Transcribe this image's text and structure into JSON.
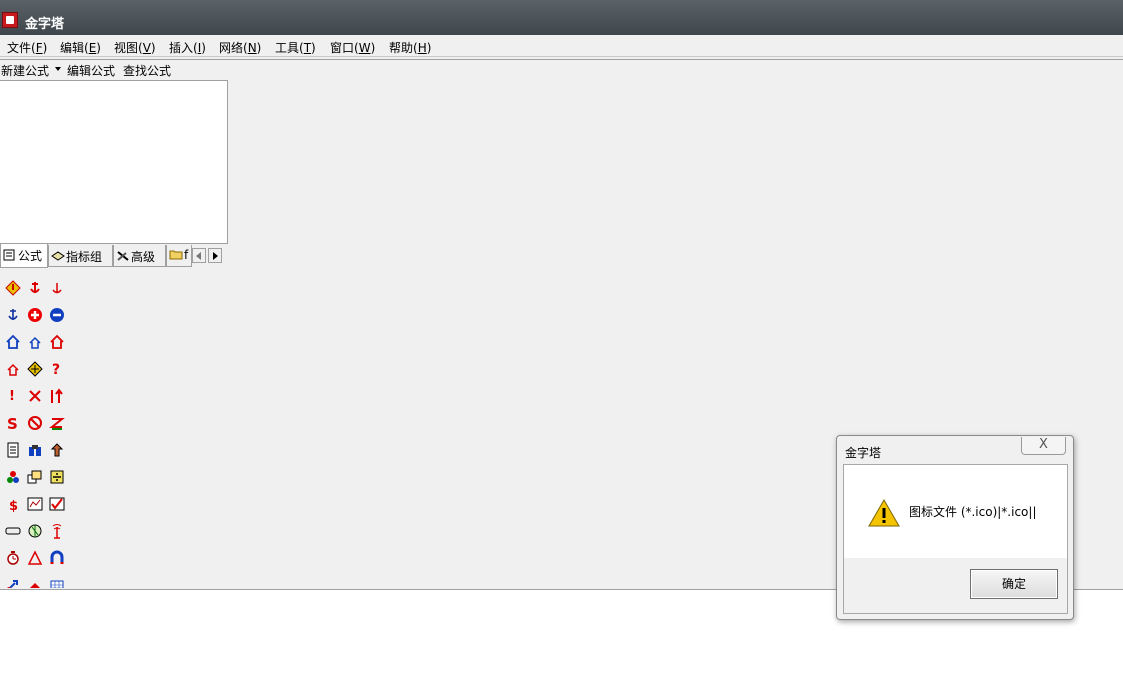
{
  "window": {
    "title": "金字塔"
  },
  "menubar": {
    "items": [
      {
        "label": "文件(",
        "key": "F",
        "close": ")"
      },
      {
        "label": "编辑(",
        "key": "E",
        "close": ")"
      },
      {
        "label": "视图(",
        "key": "V",
        "close": ")"
      },
      {
        "label": "插入(",
        "key": "I",
        "close": ")"
      },
      {
        "label": "网络(",
        "key": "N",
        "close": ")"
      },
      {
        "label": "工具(",
        "key": "T",
        "close": ")"
      },
      {
        "label": "窗口(",
        "key": "W",
        "close": ")"
      },
      {
        "label": "帮助(",
        "key": "H",
        "close": ")"
      }
    ]
  },
  "toolbar": {
    "new_formula": "新建公式",
    "edit_formula": "编辑公式",
    "find_formula": "查找公式"
  },
  "tabs": [
    {
      "label": "公式",
      "icon": "document-icon"
    },
    {
      "label": "指标组",
      "icon": "stack-icon"
    },
    {
      "label": "高级",
      "icon": "tools-icon"
    },
    {
      "label": "f",
      "icon": "folder-icon"
    }
  ],
  "icon_grid": [
    "red-diamond-icon",
    "red-anchor-icon",
    "red-anchor-small-icon",
    "blue-anchor-icon",
    "plus-circle-icon",
    "minus-circle-icon",
    "home-blue-icon",
    "home-blue-small-icon",
    "home-red-icon",
    "home-red-small-icon",
    "compass-diamond-icon",
    "question-red-icon",
    "exclamation-red-icon",
    "cross-red-icon",
    "bar-arrow-up-icon",
    "s-letter-icon",
    "no-entry-icon",
    "z-arrow-icon",
    "page-list-icon",
    "binoculars-icon",
    "house-arrow-icon",
    "color-balls-icon",
    "stacked-windows-icon",
    "split-box-icon",
    "dollar-icon",
    "chart-frame-icon",
    "checkmark-chart-icon",
    "bar-shape-icon",
    "globe-icon",
    "antenna-icon",
    "clock-icon",
    "triangle-icon",
    "magnet-icon",
    "arrow-icon",
    "red-shape-icon",
    "grid-icon"
  ],
  "dialog": {
    "title": "金字塔",
    "close_glyph": "X",
    "message": "图标文件 (*.ico)|*.ico||",
    "ok_label": "确定"
  },
  "colors": {
    "titlebar": "#4a5157",
    "accent_red": "#c8191e",
    "warning_yellow": "#f5c400"
  }
}
